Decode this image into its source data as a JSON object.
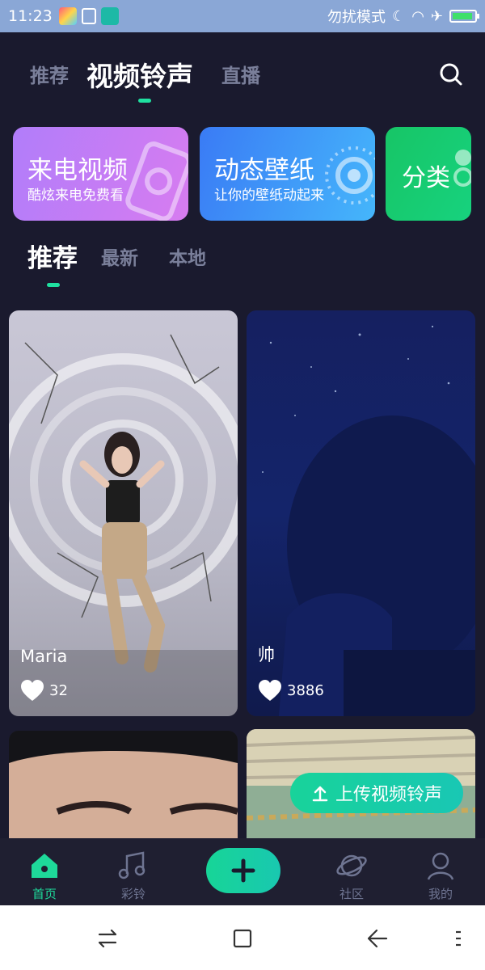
{
  "status": {
    "time": "11:23",
    "dnd": "勿扰模式"
  },
  "topnav": {
    "tabs": [
      {
        "label": "推荐"
      },
      {
        "label": "视频铃声"
      },
      {
        "label": "直播"
      }
    ]
  },
  "features": [
    {
      "title": "来电视频",
      "subtitle": "酷炫来电免费看"
    },
    {
      "title": "动态壁纸",
      "subtitle": "让你的壁纸动起来"
    },
    {
      "title": "分类"
    }
  ],
  "subtabs": [
    {
      "label": "推荐"
    },
    {
      "label": "最新"
    },
    {
      "label": "本地"
    }
  ],
  "videos": [
    {
      "name": "Maria",
      "likes": "32"
    },
    {
      "name": "帅",
      "likes": "3886"
    }
  ],
  "upload_label": "上传视频铃声",
  "tabbar": [
    {
      "label": "首页"
    },
    {
      "label": "彩铃"
    },
    {
      "label": "社区"
    },
    {
      "label": "我的"
    }
  ],
  "colors": {
    "accent": "#1ed99a",
    "background": "#1a1a2e"
  }
}
